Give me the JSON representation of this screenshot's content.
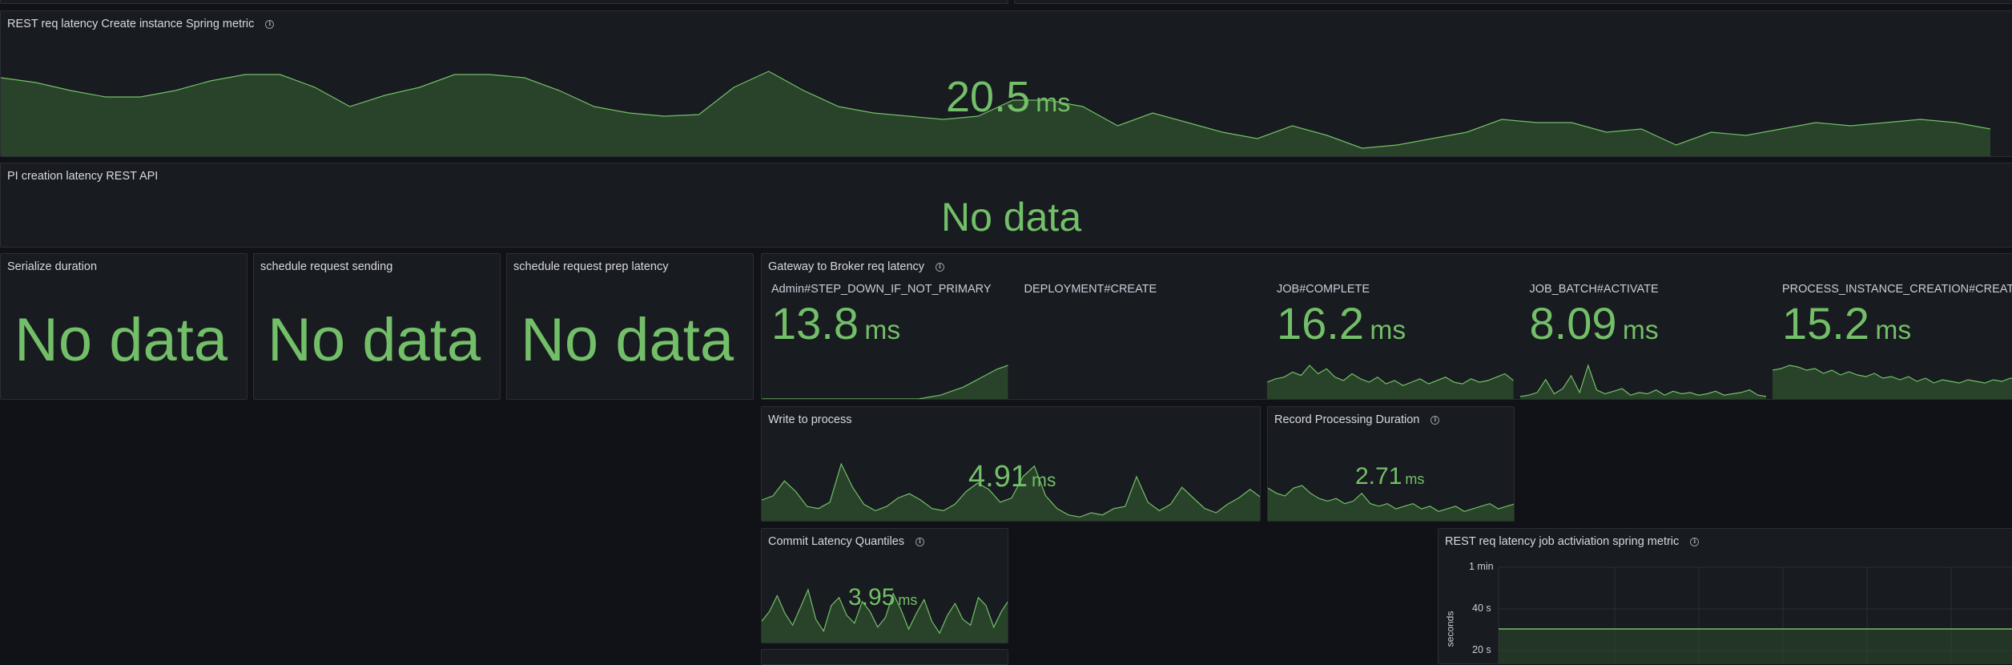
{
  "panels": {
    "rest_create": {
      "title": "REST req latency Create instance Spring metric",
      "value": "20.5",
      "unit": "ms",
      "series": [
        48,
        45,
        40,
        36,
        36,
        40,
        46,
        50,
        50,
        42,
        30,
        37,
        42,
        50,
        50,
        48,
        40,
        30,
        26,
        24,
        25,
        42,
        52,
        40,
        30,
        26,
        24,
        22,
        24,
        34,
        34,
        30,
        18,
        26,
        20,
        14,
        10,
        18,
        12,
        4,
        6,
        10,
        14,
        22,
        20,
        20,
        14,
        16,
        6,
        14,
        12,
        16,
        20,
        18,
        20,
        22,
        20,
        16
      ]
    },
    "pi_creation": {
      "title": "PI creation latency REST API",
      "nodata": "No data"
    },
    "serialize": {
      "title": "Serialize duration",
      "nodata": "No data"
    },
    "schedule_sending": {
      "title": "schedule request sending",
      "nodata": "No data"
    },
    "schedule_prep": {
      "title": "schedule request prep latency",
      "nodata": "No data"
    },
    "gateway": {
      "title": "Gateway to Broker req latency",
      "items": [
        {
          "label": "Admin#STEP_DOWN_IF_NOT_PRIMARY",
          "value": "13.8",
          "unit": "ms",
          "series": [
            0,
            0,
            0,
            0,
            0,
            0,
            0,
            0,
            0,
            0,
            0,
            0,
            0,
            0,
            0,
            1,
            2,
            4,
            6,
            9,
            12,
            15,
            17
          ]
        },
        {
          "label": "DEPLOYMENT#CREATE",
          "value": "",
          "unit": "",
          "series": []
        },
        {
          "label": "JOB#COMPLETE",
          "value": "16.2",
          "unit": "ms",
          "series": [
            20,
            24,
            26,
            32,
            28,
            40,
            30,
            36,
            26,
            22,
            30,
            24,
            20,
            26,
            18,
            22,
            16,
            20,
            24,
            18,
            22,
            26,
            20,
            18,
            24,
            20,
            22,
            26,
            30,
            22
          ]
        },
        {
          "label": "JOB_BATCH#ACTIVATE",
          "value": "8.09",
          "unit": "ms",
          "series": [
            4,
            6,
            10,
            30,
            8,
            16,
            36,
            10,
            52,
            14,
            8,
            12,
            16,
            6,
            10,
            8,
            14,
            6,
            12,
            8,
            10,
            6,
            8,
            12,
            6,
            8,
            10,
            14,
            6,
            4
          ]
        },
        {
          "label": "PROCESS_INSTANCE_CREATION#CREATE",
          "value": "15.2",
          "unit": "ms",
          "series": [
            36,
            38,
            42,
            40,
            36,
            38,
            32,
            36,
            30,
            34,
            30,
            28,
            32,
            26,
            28,
            24,
            28,
            22,
            26,
            20,
            24,
            22,
            20,
            24,
            22,
            20,
            24,
            22,
            26,
            24
          ]
        }
      ]
    },
    "write_to_process": {
      "title": "Write to process",
      "value": "4.91",
      "unit": "ms",
      "series": [
        18,
        22,
        36,
        26,
        12,
        10,
        16,
        52,
        30,
        14,
        8,
        12,
        20,
        24,
        18,
        10,
        8,
        14,
        26,
        34,
        28,
        16,
        20,
        40,
        50,
        22,
        10,
        4,
        2,
        6,
        4,
        10,
        12,
        40,
        16,
        8,
        14,
        30,
        20,
        10,
        6,
        14,
        20,
        28,
        20
      ]
    },
    "record_processing": {
      "title": "Record Processing Duration",
      "value": "2.71",
      "unit": "ms",
      "series": [
        24,
        20,
        18,
        24,
        26,
        20,
        16,
        14,
        16,
        12,
        14,
        20,
        12,
        10,
        12,
        8,
        10,
        12,
        8,
        10,
        6,
        8,
        10,
        6,
        8,
        10,
        12,
        8,
        10,
        12
      ]
    },
    "commit_latency": {
      "title": "Commit Latency Quantiles",
      "value": "3.95",
      "unit": "ms",
      "series": [
        20,
        30,
        46,
        28,
        16,
        34,
        52,
        22,
        10,
        36,
        44,
        26,
        18,
        40,
        30,
        14,
        24,
        48,
        32,
        12,
        28,
        42,
        20,
        8,
        26,
        38,
        22,
        16,
        44,
        36,
        14,
        30,
        42
      ]
    },
    "rest_job": {
      "title": "REST req latency job activiation spring metric",
      "yaxis": {
        "label": "seconds",
        "ticks": [
          "1 min",
          "40 s",
          "20 s"
        ]
      },
      "series_color": "#73bf69"
    }
  }
}
